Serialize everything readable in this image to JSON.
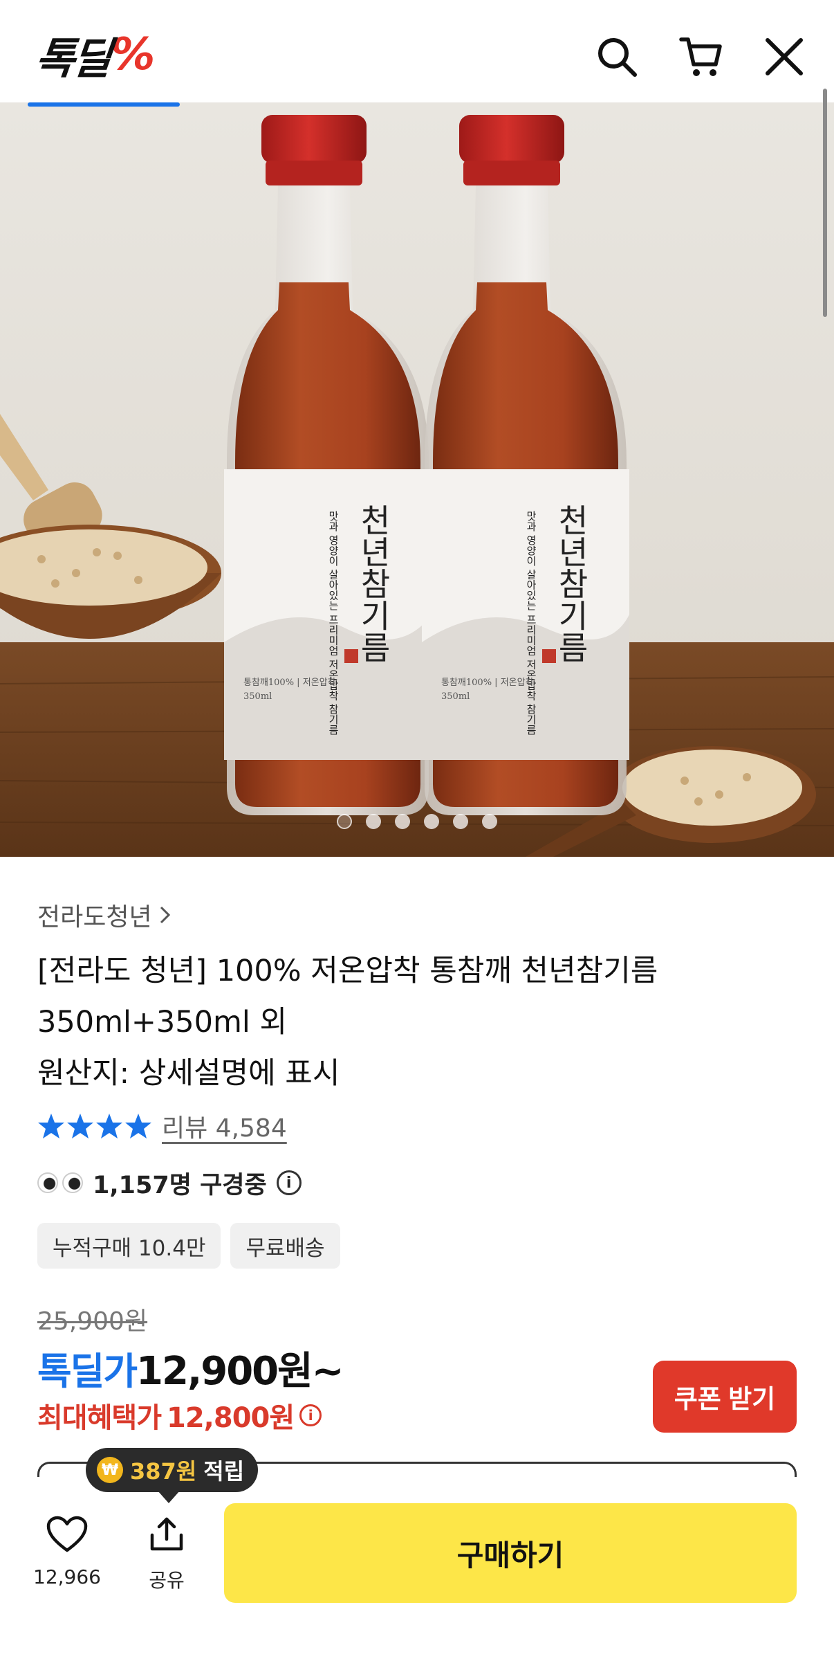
{
  "header": {
    "logo_text": "톡딜",
    "logo_mark": "%",
    "icons": [
      "search-icon",
      "cart-icon",
      "close-icon"
    ]
  },
  "gallery": {
    "image_alt": "천년참기름 두 병과 참깨",
    "bottle_label_title": "천년참기름",
    "bottle_label_sub": "맛과 영양이 살아있는 프리미엄 저온압착 참기름",
    "bottle_label_spec": "통참깨100% | 저온압착",
    "bottle_volume": "350ml",
    "total_slides": 6,
    "active_slide": 1
  },
  "product": {
    "seller": "전라도청년",
    "title_lines": [
      "[전라도 청년] 100% 저온압착 통참깨 천년참기름",
      "350ml+350ml 외",
      "원산지: 상세설명에 표시"
    ],
    "rating_stars": 4,
    "review_text": "리뷰 4,584",
    "viewers_text": "1,157명 구경중",
    "tags": [
      "누적구매 10.4만",
      "무료배송"
    ]
  },
  "price": {
    "original": "25,900원",
    "deal_label": "톡딜가",
    "deal_value": "12,900원~",
    "benefit_label": "최대혜택가",
    "benefit_value": "12,800원",
    "coupon_button": "쿠폰 받기"
  },
  "tooltip": {
    "amount": "387원",
    "suffix": "적립"
  },
  "bottom_bar": {
    "like_count": "12,966",
    "share_label": "공유",
    "buy_label": "구매하기"
  },
  "colors": {
    "brand_blue": "#1a73e8",
    "accent_red": "#e0392a",
    "buy_yellow": "#fde648"
  }
}
